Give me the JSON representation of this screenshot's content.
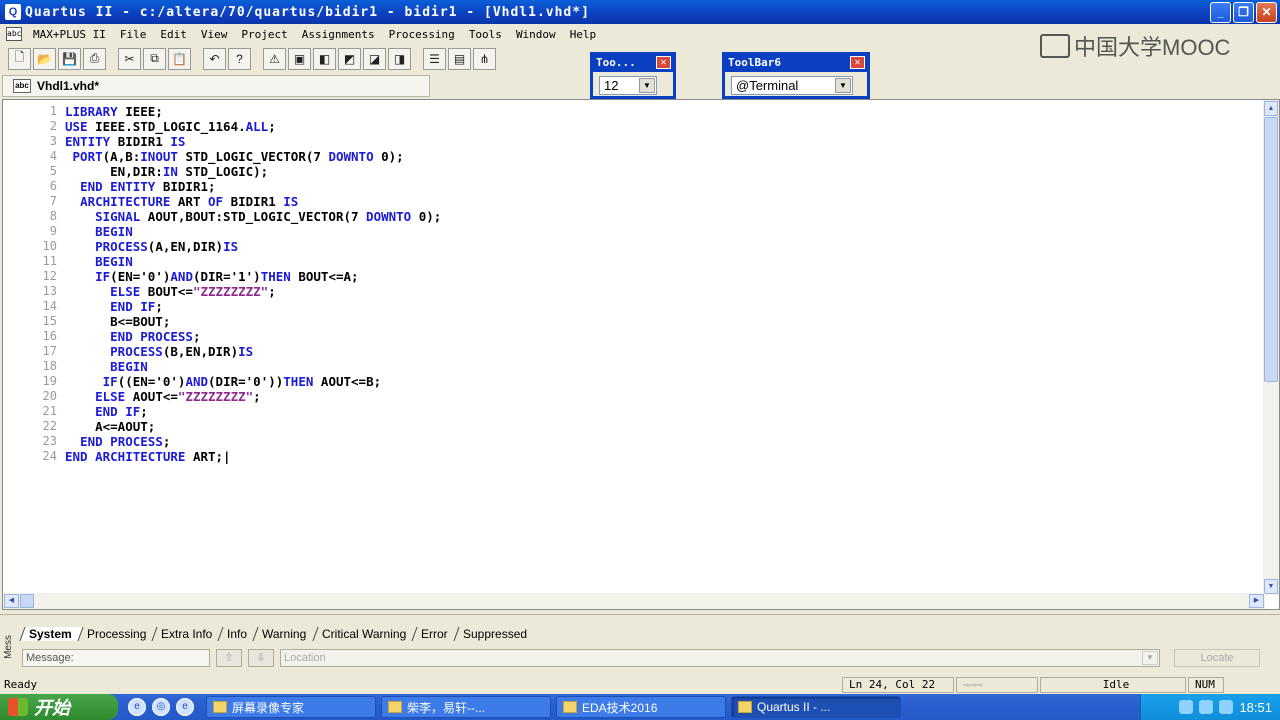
{
  "window": {
    "title": "Quartus II - c:/altera/70/quartus/bidir1 - bidir1 - [Vhdl1.vhd*]"
  },
  "menu": [
    "MAX+PLUS II",
    "File",
    "Edit",
    "View",
    "Project",
    "Assignments",
    "Processing",
    "Tools",
    "Window",
    "Help"
  ],
  "float_toolbars": [
    {
      "title": "Too...",
      "value": "12"
    },
    {
      "title": "ToolBar6",
      "value": "@Terminal"
    }
  ],
  "watermark": "中国大学MOOC",
  "doc_tab": "Vhdl1.vhd*",
  "code_lines": [
    [
      [
        "kw",
        "LIBRARY "
      ],
      [
        "tx",
        "IEEE;"
      ]
    ],
    [
      [
        "kw",
        "USE "
      ],
      [
        "tx",
        "IEEE.STD_LOGIC_1164."
      ],
      [
        "kw",
        "ALL"
      ],
      [
        "tx",
        ";"
      ]
    ],
    [
      [
        "kw",
        "ENTITY "
      ],
      [
        "tx",
        "BIDIR1 "
      ],
      [
        "kw",
        "IS"
      ]
    ],
    [
      [
        "tx",
        " "
      ],
      [
        "kw",
        "PORT"
      ],
      [
        "tx",
        "(A,B:"
      ],
      [
        "kw",
        "INOUT "
      ],
      [
        "tx",
        "STD_LOGIC_VECTOR(7 "
      ],
      [
        "kw",
        "DOWNTO "
      ],
      [
        "tx",
        "0);"
      ]
    ],
    [
      [
        "tx",
        "      EN,DIR:"
      ],
      [
        "kw",
        "IN "
      ],
      [
        "tx",
        "STD_LOGIC);"
      ]
    ],
    [
      [
        "tx",
        "  "
      ],
      [
        "kw",
        "END ENTITY "
      ],
      [
        "tx",
        "BIDIR1;"
      ]
    ],
    [
      [
        "tx",
        "  "
      ],
      [
        "kw",
        "ARCHITECTURE "
      ],
      [
        "tx",
        "ART "
      ],
      [
        "kw",
        "OF "
      ],
      [
        "tx",
        "BIDIR1 "
      ],
      [
        "kw",
        "IS"
      ]
    ],
    [
      [
        "tx",
        "    "
      ],
      [
        "kw",
        "SIGNAL "
      ],
      [
        "tx",
        "AOUT,BOUT:STD_LOGIC_VECTOR(7 "
      ],
      [
        "kw",
        "DOWNTO "
      ],
      [
        "tx",
        "0);"
      ]
    ],
    [
      [
        "tx",
        "    "
      ],
      [
        "kw",
        "BEGIN"
      ]
    ],
    [
      [
        "tx",
        "    "
      ],
      [
        "kw",
        "PROCESS"
      ],
      [
        "tx",
        "(A,EN,DIR)"
      ],
      [
        "kw",
        "IS"
      ]
    ],
    [
      [
        "tx",
        "    "
      ],
      [
        "kw",
        "BEGIN"
      ]
    ],
    [
      [
        "tx",
        "    "
      ],
      [
        "kw",
        "IF"
      ],
      [
        "tx",
        "(EN='0')"
      ],
      [
        "kw",
        "AND"
      ],
      [
        "tx",
        "(DIR='1')"
      ],
      [
        "kw",
        "THEN "
      ],
      [
        "tx",
        "BOUT<=A;"
      ]
    ],
    [
      [
        "tx",
        "      "
      ],
      [
        "kw",
        "ELSE "
      ],
      [
        "tx",
        "BOUT<="
      ],
      [
        "str",
        "\"ZZZZZZZZ\""
      ],
      [
        "tx",
        ";"
      ]
    ],
    [
      [
        "tx",
        "      "
      ],
      [
        "kw",
        "END IF"
      ],
      [
        "tx",
        ";"
      ]
    ],
    [
      [
        "tx",
        "      B<=BOUT;"
      ]
    ],
    [
      [
        "tx",
        "      "
      ],
      [
        "kw",
        "END PROCESS"
      ],
      [
        "tx",
        ";"
      ]
    ],
    [
      [
        "tx",
        "      "
      ],
      [
        "kw",
        "PROCESS"
      ],
      [
        "tx",
        "(B,EN,DIR)"
      ],
      [
        "kw",
        "IS"
      ]
    ],
    [
      [
        "tx",
        "      "
      ],
      [
        "kw",
        "BEGIN"
      ]
    ],
    [
      [
        "tx",
        "     "
      ],
      [
        "kw",
        "IF"
      ],
      [
        "tx",
        "((EN='0')"
      ],
      [
        "kw",
        "AND"
      ],
      [
        "tx",
        "(DIR='0'))"
      ],
      [
        "kw",
        "THEN "
      ],
      [
        "tx",
        "AOUT<=B;"
      ]
    ],
    [
      [
        "tx",
        "    "
      ],
      [
        "kw",
        "ELSE "
      ],
      [
        "tx",
        "AOUT<="
      ],
      [
        "str",
        "\"ZZZZZZZZ\""
      ],
      [
        "tx",
        ";"
      ]
    ],
    [
      [
        "tx",
        "    "
      ],
      [
        "kw",
        "END IF"
      ],
      [
        "tx",
        ";"
      ]
    ],
    [
      [
        "tx",
        "    A<=AOUT;"
      ]
    ],
    [
      [
        "tx",
        "  "
      ],
      [
        "kw",
        "END PROCESS"
      ],
      [
        "tx",
        ";"
      ]
    ],
    [
      [
        "kw",
        "END ARCHITECTURE "
      ],
      [
        "tx",
        "ART;|"
      ]
    ]
  ],
  "messages": {
    "side_label": "Mess",
    "tabs": [
      "System",
      "Processing",
      "Extra Info",
      "Info",
      "Warning",
      "Critical Warning",
      "Error",
      "Suppressed"
    ],
    "message_label": "Message:",
    "location_placeholder": "Location",
    "locate_label": "Locate"
  },
  "status": {
    "ready": "Ready",
    "position": "Ln 24, Col 22",
    "state": "Idle",
    "num": "NUM"
  },
  "taskbar": {
    "start": "开始",
    "tasks": [
      "屏幕录像专家",
      "柴李，易轩--...",
      "EDA技术2016",
      "Quartus II - ..."
    ],
    "clock": "18:51"
  }
}
